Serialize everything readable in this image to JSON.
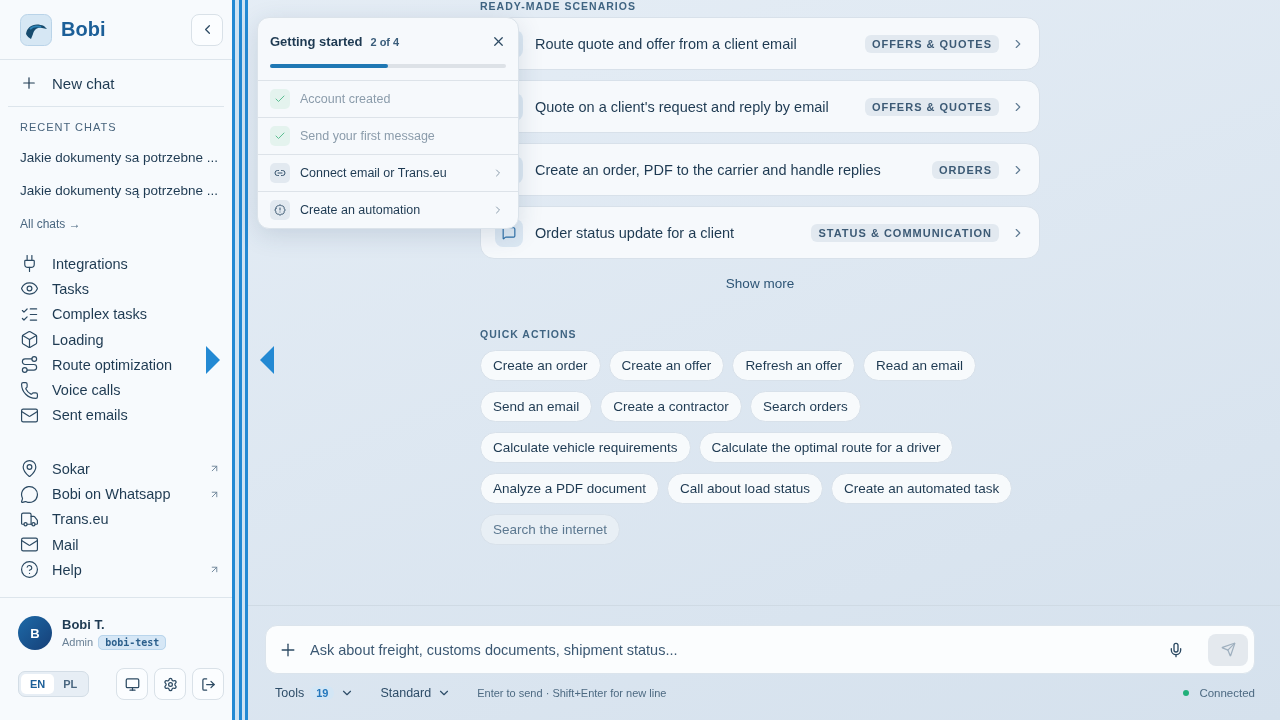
{
  "sidebar": {
    "brand": "Bobi",
    "new_chat": "New chat",
    "recent_heading": "RECENT CHATS",
    "recent_chats": [
      "Jakie dokumenty sa potrzebne ...",
      "Jakie dokumenty są potrzebne ..."
    ],
    "all_chats": "All chats →",
    "nav": [
      {
        "label": "Integrations"
      },
      {
        "label": "Tasks"
      },
      {
        "label": "Complex tasks"
      },
      {
        "label": "Loading"
      },
      {
        "label": "Route optimization"
      },
      {
        "label": "Voice calls"
      },
      {
        "label": "Sent emails"
      }
    ],
    "links": [
      {
        "label": "Sokar",
        "external": true
      },
      {
        "label": "Bobi on Whatsapp",
        "external": true
      },
      {
        "label": "Trans.eu",
        "external": false
      },
      {
        "label": "Mail",
        "external": false
      },
      {
        "label": "Help",
        "external": true
      }
    ],
    "user": {
      "initial": "B",
      "name": "Bobi T.",
      "role": "Admin",
      "workspace": "bobi-test"
    },
    "languages": [
      {
        "label": "EN",
        "selected": true
      },
      {
        "label": "PL",
        "selected": false
      }
    ]
  },
  "getting_started": {
    "title": "Getting started",
    "progress": "2 of 4",
    "level": 0.5,
    "steps": [
      {
        "label": "Account created",
        "done": true
      },
      {
        "label": "Send your first message",
        "done": true
      },
      {
        "label": "Connect email or Trans.eu",
        "done": false
      },
      {
        "label": "Create an automation",
        "done": false
      }
    ]
  },
  "scenarios": {
    "heading": "READY-MADE SCENARIOS",
    "items": [
      {
        "title": "Route quote and offer from a client email",
        "tag": "OFFERS & QUOTES"
      },
      {
        "title": "Quote on a client's request and reply by email",
        "tag": "OFFERS & QUOTES"
      },
      {
        "title": "Create an order, PDF to the carrier and handle replies",
        "tag": "ORDERS"
      },
      {
        "title": "Order status update for a client",
        "tag": "STATUS & COMMUNICATION"
      }
    ],
    "show_more": "Show more"
  },
  "quick_actions": {
    "heading": "QUICK ACTIONS",
    "actions": [
      {
        "label": "Create an order",
        "disabled": false
      },
      {
        "label": "Create an offer",
        "disabled": false
      },
      {
        "label": "Refresh an offer",
        "disabled": false
      },
      {
        "label": "Read an email",
        "disabled": false
      },
      {
        "label": "Send an email",
        "disabled": false
      },
      {
        "label": "Create a contractor",
        "disabled": false
      },
      {
        "label": "Search orders",
        "disabled": false
      },
      {
        "label": "Calculate vehicle requirements",
        "disabled": false
      },
      {
        "label": "Calculate the optimal route for a driver",
        "disabled": false
      },
      {
        "label": "Analyze a PDF document",
        "disabled": false
      },
      {
        "label": "Call about load status",
        "disabled": false
      },
      {
        "label": "Create an automated task",
        "disabled": false
      },
      {
        "label": "Search the internet",
        "disabled": true
      }
    ]
  },
  "composer": {
    "placeholder": "Ask about freight, customs documents, shipment status...",
    "tools": "Tools",
    "tools_count": "19",
    "mode": "Standard",
    "hint": "Enter to send · Shift+Enter for new line",
    "status": "Connected",
    "connected": true
  }
}
